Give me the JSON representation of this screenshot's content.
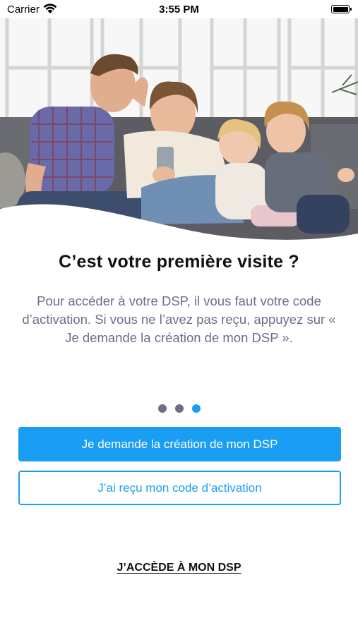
{
  "status_bar": {
    "carrier": "Carrier",
    "time": "3:55 PM"
  },
  "hero": {
    "image": "family-on-sofa-photo"
  },
  "onboarding": {
    "title": "C’est votre première visite ?",
    "description": "Pour accéder à votre DSP, il vous faut votre code d’activation. Si vous ne l’avez pas reçu, appuyez sur « Je demande la création de mon DSP ».",
    "page_indicator": {
      "total": 3,
      "current": 3
    }
  },
  "actions": {
    "primary_label": "Je demande la création de mon DSP",
    "secondary_label": "J’ai reçu mon code d’activation",
    "link_label": "J’ACCÈDE À MON DSP"
  },
  "colors": {
    "accent": "#1a9ef3",
    "body_text": "#6b6f8a",
    "title_text": "#111111"
  }
}
